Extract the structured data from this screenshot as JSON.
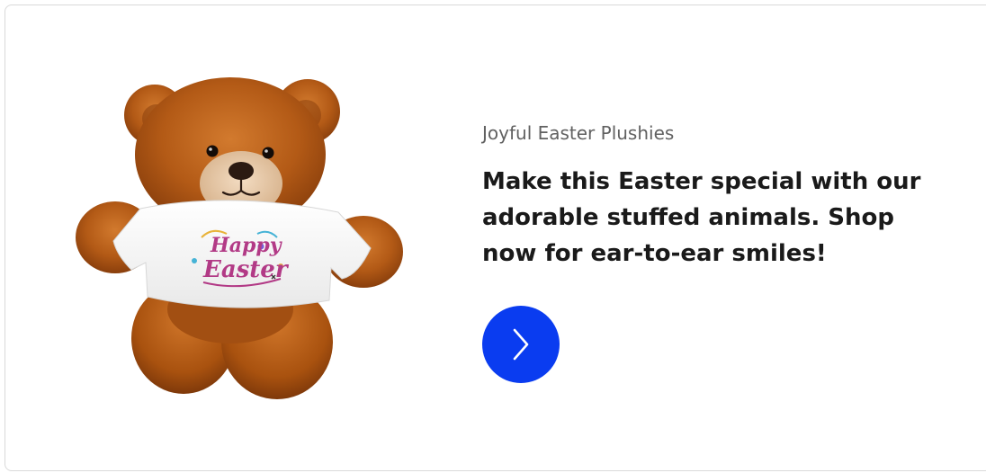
{
  "card": {
    "eyebrow": "Joyful Easter Plushies",
    "headline": "Make this Easter special with our adorable stuffed animals. Shop now for ear-to-ear smiles!",
    "image": {
      "icon": "teddy-bear-easter-shirt",
      "shirt_text": [
        "Happy",
        "Easter"
      ]
    },
    "cta": {
      "icon": "chevron-right-icon"
    }
  },
  "colors": {
    "accent": "#0a3cf0",
    "fur": "#b35a16",
    "fur_dark": "#8a3f0c",
    "fur_light": "#d27a2e",
    "shirt": "#f7f7f7",
    "shirt_text": "#b23a86",
    "headline": "#1a1a1a",
    "eyebrow": "#616161",
    "border": "#d9d9d9"
  }
}
